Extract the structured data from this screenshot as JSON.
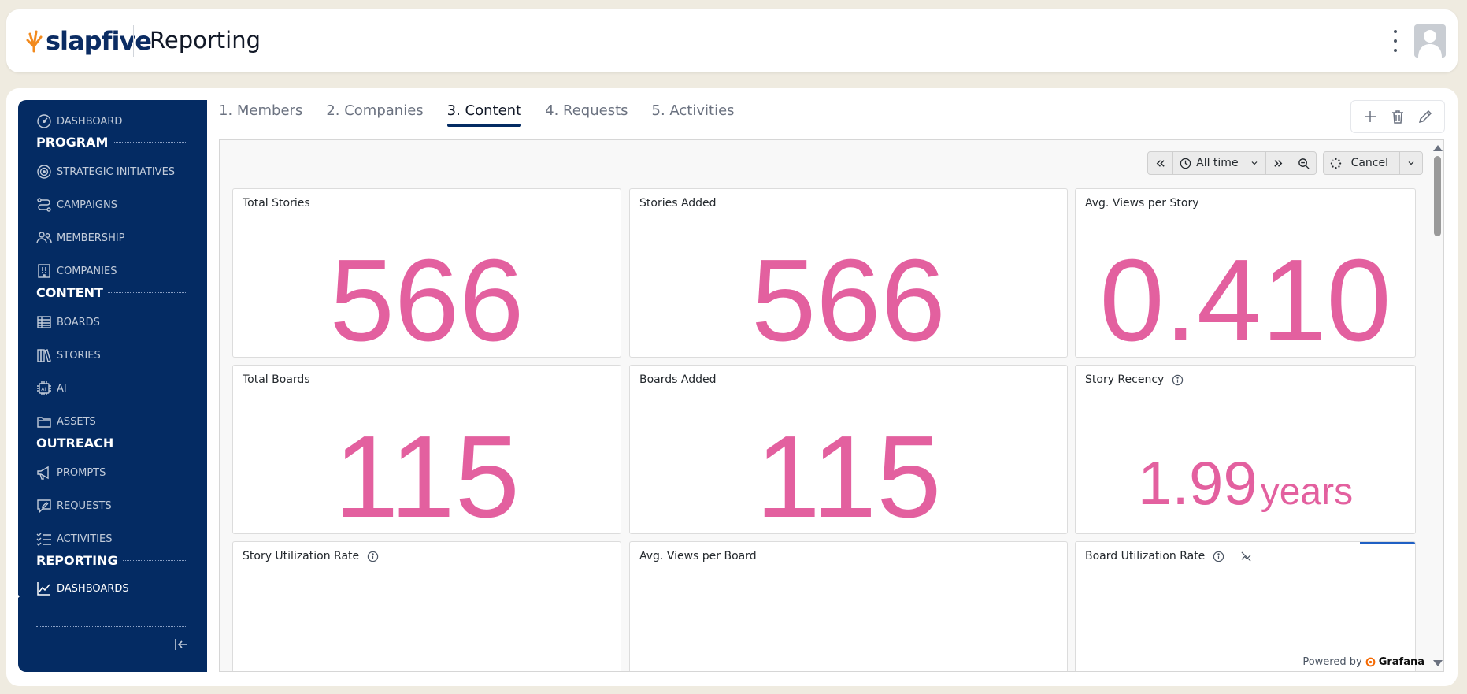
{
  "header": {
    "logo_text": "slapfive",
    "title": "Reporting",
    "brand_color": "#0b2c63",
    "accent_color": "#f28a1e"
  },
  "sidebar": {
    "items": [
      {
        "label": "DASHBOARD",
        "icon": "gauge-icon"
      },
      {
        "section": "PROGRAM"
      },
      {
        "label": "STRATEGIC INITIATIVES",
        "icon": "target-icon"
      },
      {
        "label": "CAMPAIGNS",
        "icon": "route-icon"
      },
      {
        "label": "MEMBERSHIP",
        "icon": "people-icon"
      },
      {
        "label": "COMPANIES",
        "icon": "building-icon"
      },
      {
        "section": "CONTENT"
      },
      {
        "label": "BOARDS",
        "icon": "table-icon"
      },
      {
        "label": "STORIES",
        "icon": "books-icon"
      },
      {
        "label": "AI",
        "icon": "chip-icon"
      },
      {
        "label": "ASSETS",
        "icon": "folder-icon"
      },
      {
        "section": "OUTREACH"
      },
      {
        "label": "PROMPTS",
        "icon": "megaphone-icon"
      },
      {
        "label": "REQUESTS",
        "icon": "message-edit-icon"
      },
      {
        "label": "ACTIVITIES",
        "icon": "checklist-icon"
      },
      {
        "section": "REPORTING"
      },
      {
        "label": "DASHBOARDS",
        "icon": "line-chart-icon",
        "active": true
      }
    ]
  },
  "tabs": [
    {
      "label": "1. Members"
    },
    {
      "label": "2. Companies"
    },
    {
      "label": "3. Content",
      "active": true
    },
    {
      "label": "4. Requests"
    },
    {
      "label": "5. Activities"
    }
  ],
  "controls": {
    "time_range": "All time",
    "cancel_label": "Cancel"
  },
  "panels": [
    {
      "title": "Total Stories",
      "value": "566"
    },
    {
      "title": "Stories Added",
      "value": "566"
    },
    {
      "title": "Avg. Views per Story",
      "value": "0.410"
    },
    {
      "title": "Total Boards",
      "value": "115"
    },
    {
      "title": "Boards Added",
      "value": "115"
    },
    {
      "title": "Story Recency",
      "value": "1.99",
      "unit": "years"
    },
    {
      "title": "Story Utilization Rate"
    },
    {
      "title": "Avg. Views per Board"
    },
    {
      "title": "Board Utilization Rate"
    }
  ],
  "stat_color": "#e3609f",
  "footer": {
    "powered_by": "Powered by",
    "brand": "Grafana"
  }
}
